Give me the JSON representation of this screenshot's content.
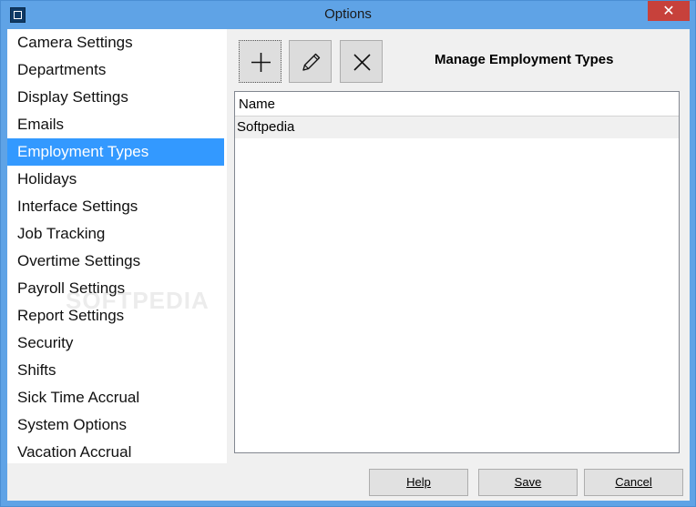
{
  "window": {
    "title": "Options",
    "close_glyph": "✕"
  },
  "sidebar": {
    "items": [
      {
        "label": "Camera Settings"
      },
      {
        "label": "Departments"
      },
      {
        "label": "Display Settings"
      },
      {
        "label": "Emails"
      },
      {
        "label": "Employment Types",
        "selected": true
      },
      {
        "label": "Holidays"
      },
      {
        "label": "Interface Settings"
      },
      {
        "label": "Job Tracking"
      },
      {
        "label": "Overtime Settings"
      },
      {
        "label": "Payroll Settings"
      },
      {
        "label": "Report Settings"
      },
      {
        "label": "Security"
      },
      {
        "label": "Shifts"
      },
      {
        "label": "Sick Time Accrual"
      },
      {
        "label": "System Options"
      },
      {
        "label": "Vacation Accrual"
      }
    ]
  },
  "toolbar": {
    "add_icon": "plus-icon",
    "edit_icon": "pencil-icon",
    "delete_icon": "x-icon"
  },
  "panel": {
    "title": "Manage Employment Types"
  },
  "grid": {
    "columns": [
      "Name"
    ],
    "rows": [
      [
        "Softpedia"
      ]
    ]
  },
  "buttons": {
    "help": "Help",
    "save": "Save",
    "cancel": "Cancel"
  },
  "watermark": "SOFTPEDIA",
  "colors": {
    "titlebar": "#5fa3e6",
    "selection": "#3399ff",
    "close": "#c7413b"
  }
}
